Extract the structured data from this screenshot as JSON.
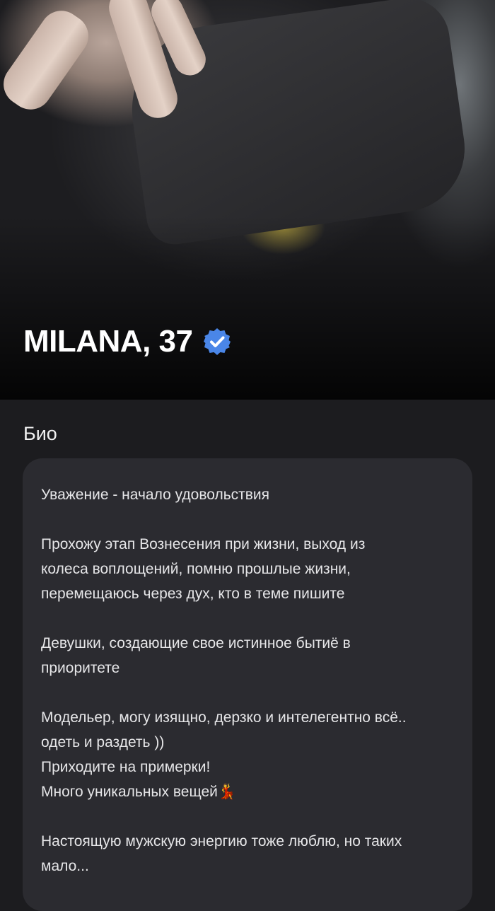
{
  "profile": {
    "name_age": "MILANA, 37",
    "verified": true,
    "verified_color": "#4a86e8"
  },
  "bio": {
    "title": "Био",
    "paragraphs": [
      [
        "Уважение - начало удовольствия"
      ],
      [
        "Прохожу этап Вознесения при жизни, выход из",
        "колеса воплощений, помню прошлые жизни,",
        "перемещаюсь через дух, кто в теме пишите"
      ],
      [
        "Девушки, создающие свое истинное бытиё в",
        "приоритете"
      ],
      [
        "Модельер, могу изящно, дерзко и интелегентно всё..",
        "одеть и раздеть ))",
        "Приходите на примерки!",
        "Много уникальных вещей💃"
      ],
      [
        "Настоящую мужскую энергию тоже люблю, но таких",
        "мало..."
      ]
    ]
  }
}
